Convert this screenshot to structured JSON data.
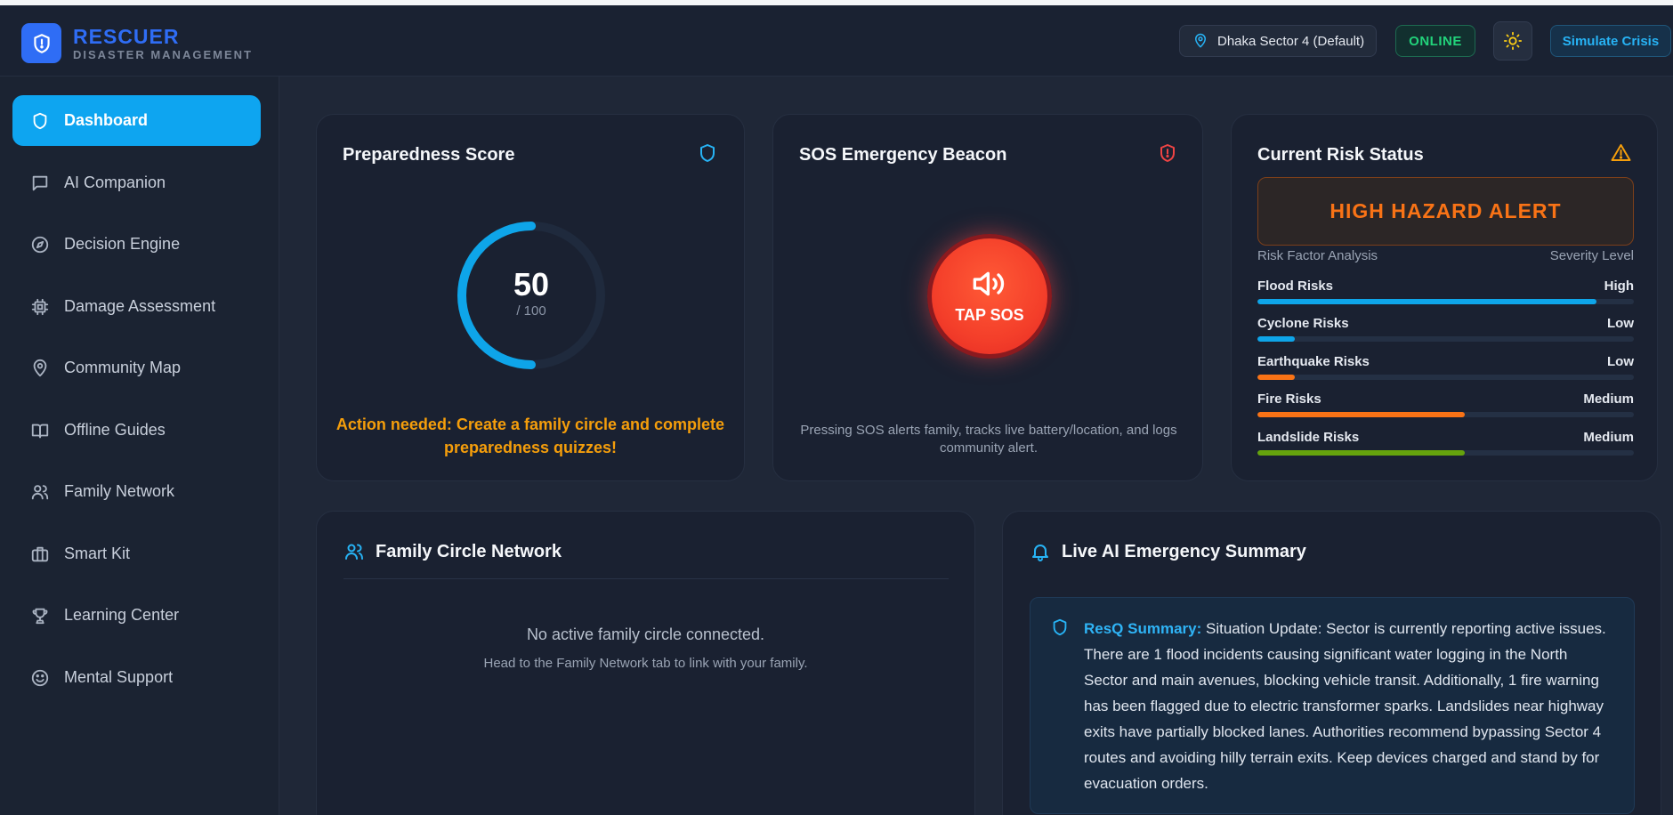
{
  "brand": {
    "title": "RESCUER",
    "subtitle": "DISASTER MANAGEMENT"
  },
  "header": {
    "location": "Dhaka Sector 4 (Default)",
    "status": "ONLINE",
    "simulate_label": "Simulate Crisis"
  },
  "sidebar": {
    "items": [
      {
        "label": "Dashboard",
        "icon": "shield-icon",
        "active": true
      },
      {
        "label": "AI Companion",
        "icon": "message-icon"
      },
      {
        "label": "Decision Engine",
        "icon": "compass-icon"
      },
      {
        "label": "Damage Assessment",
        "icon": "cpu-icon"
      },
      {
        "label": "Community Map",
        "icon": "map-pin-icon"
      },
      {
        "label": "Offline Guides",
        "icon": "book-icon"
      },
      {
        "label": "Family Network",
        "icon": "users-icon"
      },
      {
        "label": "Smart Kit",
        "icon": "briefcase-icon"
      },
      {
        "label": "Learning Center",
        "icon": "trophy-icon"
      },
      {
        "label": "Mental Support",
        "icon": "smile-icon"
      }
    ]
  },
  "preparedness": {
    "title": "Preparedness Score",
    "score": "50",
    "max": "/ 100",
    "score_fraction": 0.5,
    "warning": "Action needed: Create a family circle and complete preparedness quizzes!"
  },
  "sos": {
    "title": "SOS Emergency Beacon",
    "button_label": "TAP SOS",
    "description": "Pressing SOS alerts family, tracks live battery/location, and logs community alert."
  },
  "risk": {
    "title": "Current Risk Status",
    "alert": "HIGH HAZARD ALERT",
    "analysis_label": "Risk Factor Analysis",
    "severity_label": "Severity Level",
    "rows": [
      {
        "name": "Flood Risks",
        "level": "High",
        "fill": 0.9,
        "color": "#0ea5e9"
      },
      {
        "name": "Cyclone Risks",
        "level": "Low",
        "fill": 0.1,
        "color": "#0ea5e9"
      },
      {
        "name": "Earthquake Risks",
        "level": "Low",
        "fill": 0.1,
        "color": "#f97316"
      },
      {
        "name": "Fire Risks",
        "level": "Medium",
        "fill": 0.55,
        "color": "#f97316"
      },
      {
        "name": "Landslide Risks",
        "level": "Medium",
        "fill": 0.55,
        "color": "#65a30d"
      }
    ]
  },
  "family": {
    "title": "Family Circle Network",
    "empty_title": "No active family circle connected.",
    "empty_sub": "Head to the Family Network tab to link with your family."
  },
  "summary": {
    "title": "Live AI Emergency Summary",
    "label": "ResQ Summary:",
    "text": "Situation Update: Sector is currently reporting active issues. There are 1 flood incidents causing significant water logging in the North Sector and main avenues, blocking vehicle transit. Additionally, 1 fire warning has been flagged due to electric transformer sparks. Landslides near highway exits have partially blocked lanes. Authorities recommend bypassing Sector 4 routes and avoiding hilly terrain exits. Keep devices charged and stand by for evacuation orders."
  }
}
